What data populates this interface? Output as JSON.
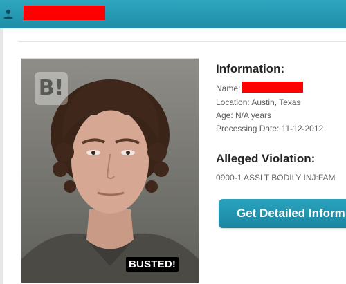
{
  "header": {
    "icon": "user-icon",
    "title_redacted": true,
    "colors": {
      "bar": "#2fa6bf",
      "redaction": "#ff0000"
    }
  },
  "photo": {
    "watermark": "B!",
    "badge": "BUSTED!"
  },
  "information": {
    "heading": "Information:",
    "name_label": "Name:",
    "location": "Location: Austin, Texas",
    "age": "Age: N/A years",
    "processing_date": "Processing Date: 11-12-2012"
  },
  "violation": {
    "heading": "Alleged Violation:",
    "text": "0900-1 ASSLT BODILY INJ:FAM"
  },
  "cta": {
    "label": "Get Detailed Inform"
  }
}
